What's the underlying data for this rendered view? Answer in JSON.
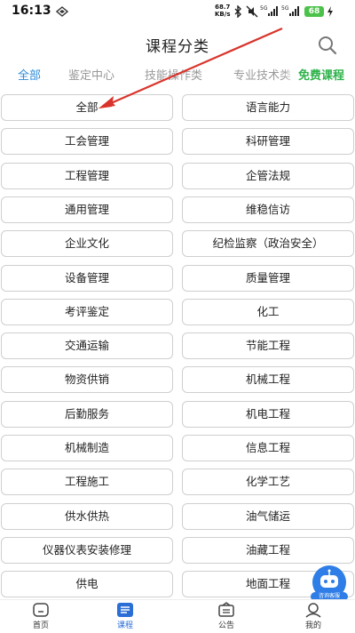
{
  "status": {
    "time": "16:13",
    "net_speed_value": "68.7",
    "net_speed_unit": "KB/s",
    "battery": "68",
    "signal_label": "5G"
  },
  "header": {
    "title": "课程分类"
  },
  "tabs": [
    "全部",
    "鉴定中心",
    "技能操作类",
    "专业技术类"
  ],
  "free_tab": "免费课程",
  "categories": [
    "全部",
    "语言能力",
    "工会管理",
    "科研管理",
    "工程管理",
    "企管法规",
    "通用管理",
    "维稳信访",
    "企业文化",
    "纪检监察（政治安全）",
    "设备管理",
    "质量管理",
    "考评鉴定",
    "化工",
    "交通运输",
    "节能工程",
    "物资供销",
    "机械工程",
    "后勤服务",
    "机电工程",
    "机械制造",
    "信息工程",
    "工程施工",
    "化学工艺",
    "供水供热",
    "油气储运",
    "仪器仪表安装修理",
    "油藏工程",
    "供电",
    "地面工程"
  ],
  "chat_fab": {
    "label": "咨询客服"
  },
  "nav": [
    {
      "label": "首页",
      "icon": "home-icon"
    },
    {
      "label": "课程",
      "icon": "courses-icon"
    },
    {
      "label": "公告",
      "icon": "announcement-icon"
    },
    {
      "label": "我的",
      "icon": "profile-icon"
    }
  ],
  "colors": {
    "accent": "#2b8bd8",
    "free": "#2eb24b",
    "annotation_arrow": "#d9342b",
    "battery": "#4cc24a"
  }
}
